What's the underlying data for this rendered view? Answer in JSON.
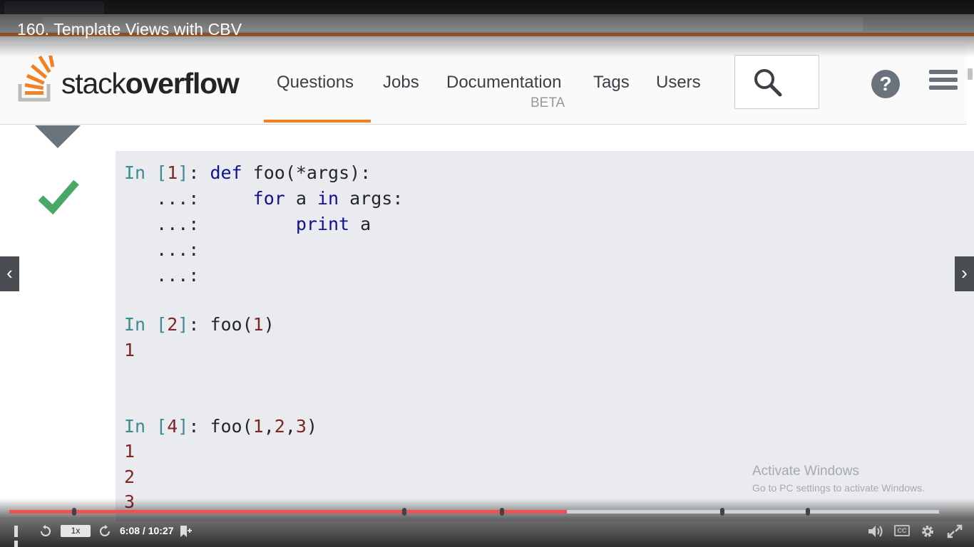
{
  "player": {
    "title": "160. Template Views with CBV",
    "speed": "1x",
    "time": "6:08 / 10:27",
    "progress_fraction": 0.6,
    "chapter_marks_fraction": [
      0.07,
      0.425,
      0.53,
      0.767,
      0.859
    ],
    "icons": [
      "pause-icon",
      "rewind-icon",
      "forward-icon",
      "bookmark-icon",
      "volume-icon",
      "captions-icon",
      "settings-icon",
      "fullscreen-icon"
    ],
    "cc_label": "CC"
  },
  "stackoverflow": {
    "brand_light": "stack",
    "brand_bold": "overflow",
    "nav": [
      "Questions",
      "Jobs",
      "Documentation",
      "Tags",
      "Users"
    ],
    "beta": "BETA",
    "active_color": "#f48024",
    "help_glyph": "?"
  },
  "code": {
    "lines": [
      {
        "prompt": "In [1]: ",
        "tokens": [
          [
            "kw",
            "def"
          ],
          [
            "plain",
            " foo(*args):"
          ]
        ]
      },
      {
        "prompt": "   ...: ",
        "tokens": [
          [
            "plain",
            "    "
          ],
          [
            "kw",
            "for"
          ],
          [
            "plain",
            " a "
          ],
          [
            "kw",
            "in"
          ],
          [
            "plain",
            " args:"
          ]
        ]
      },
      {
        "prompt": "   ...: ",
        "tokens": [
          [
            "plain",
            "        "
          ],
          [
            "kw",
            "print"
          ],
          [
            "plain",
            " a"
          ]
        ]
      },
      {
        "prompt": "   ...: ",
        "tokens": []
      },
      {
        "prompt": "   ...: ",
        "tokens": []
      },
      {
        "prompt": "In [2]: ",
        "tokens": [
          [
            "plain",
            "foo("
          ],
          [
            "num",
            "1"
          ],
          [
            "plain",
            ")"
          ]
        ]
      },
      {
        "output": "1"
      },
      {
        "prompt": "In [4]: ",
        "tokens": [
          [
            "plain",
            "foo("
          ],
          [
            "num",
            "1"
          ],
          [
            "plain",
            ","
          ],
          [
            "num",
            "2"
          ],
          [
            "plain",
            ","
          ],
          [
            "num",
            "3"
          ],
          [
            "plain",
            ")"
          ]
        ]
      },
      {
        "output": "1"
      },
      {
        "output": "2"
      },
      {
        "output": "3"
      }
    ]
  },
  "watermark": {
    "title": "Activate Windows",
    "subtitle": "Go to PC settings to activate Windows."
  },
  "arrows": {
    "prev": "‹",
    "next": "›"
  }
}
